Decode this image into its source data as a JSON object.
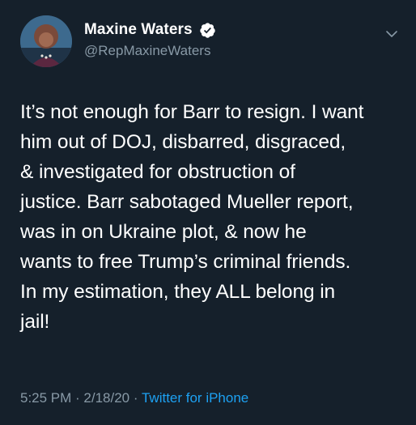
{
  "author": {
    "display_name": "Maxine Waters",
    "handle": "@RepMaxineWaters",
    "verified": true,
    "avatar_icon": "profile-photo-avatar"
  },
  "tweet": {
    "lines": [
      "It’s not enough for Barr to resign. I want",
      "him out of DOJ, disbarred, disgraced,",
      "& investigated for obstruction of",
      "justice. Barr sabotaged Mueller report,",
      "was in on Ukraine plot, & now he",
      "wants to free Trump’s criminal friends.",
      "In my estimation, they ALL belong in",
      "jail!"
    ]
  },
  "meta": {
    "time": "5:25 PM",
    "separator": " · ",
    "date": "2/18/20",
    "source": "Twitter for iPhone"
  },
  "icons": {
    "verified": "verified-badge-icon",
    "menu": "chevron-down-icon"
  },
  "colors": {
    "background": "#15202b",
    "text_primary": "#ffffff",
    "text_secondary": "#8899a6",
    "link": "#1da1f2"
  }
}
